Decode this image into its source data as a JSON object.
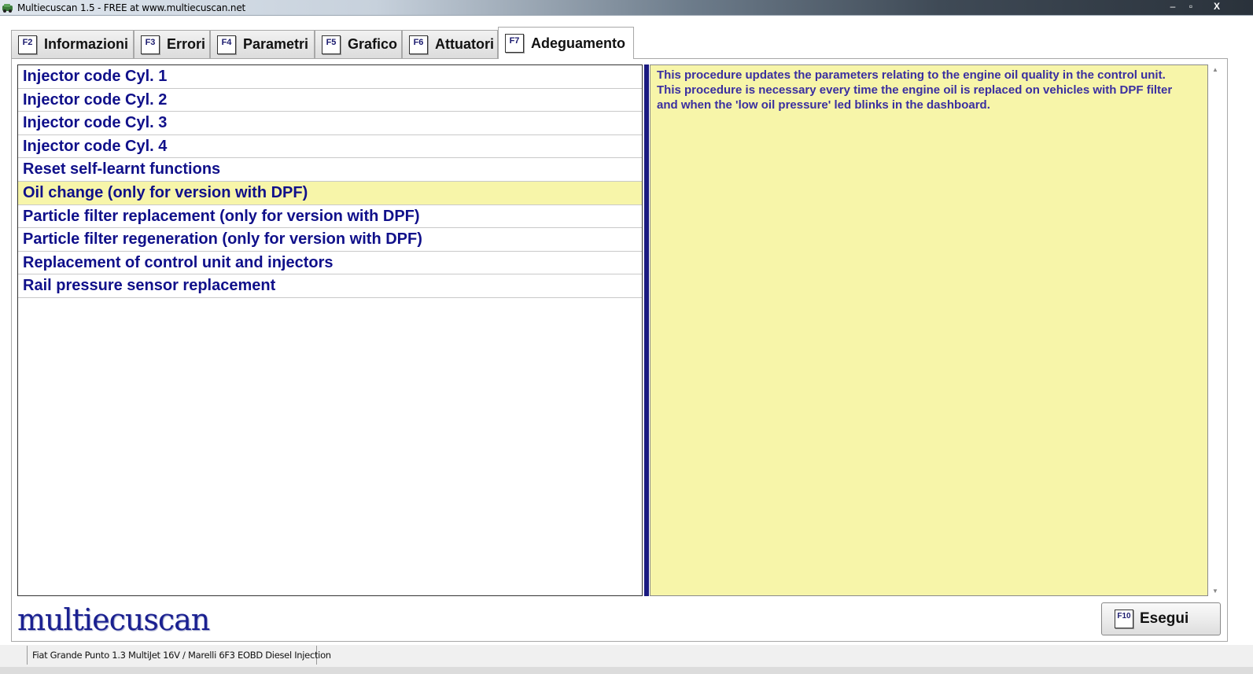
{
  "window": {
    "title": "Multiecuscan 1.5 - FREE at www.multiecuscan.net",
    "minimize_glyph": "‒",
    "maximize_glyph": "▫",
    "close_glyph": "X"
  },
  "tabs": [
    {
      "key": "F2",
      "label": "Informazioni",
      "active": false
    },
    {
      "key": "F3",
      "label": "Errori",
      "active": false
    },
    {
      "key": "F4",
      "label": "Parametri",
      "active": false
    },
    {
      "key": "F5",
      "label": "Grafico",
      "active": false
    },
    {
      "key": "F6",
      "label": "Attuatori",
      "active": false
    },
    {
      "key": "F7",
      "label": "Adeguamento",
      "active": true
    }
  ],
  "procedures": [
    {
      "label": "Injector code Cyl. 1",
      "selected": false
    },
    {
      "label": "Injector code Cyl. 2",
      "selected": false
    },
    {
      "label": "Injector code Cyl. 3",
      "selected": false
    },
    {
      "label": "Injector code Cyl. 4",
      "selected": false
    },
    {
      "label": "Reset self-learnt functions",
      "selected": false
    },
    {
      "label": "Oil change (only for version with DPF)",
      "selected": true
    },
    {
      "label": "Particle filter replacement (only for version with DPF)",
      "selected": false
    },
    {
      "label": "Particle filter regeneration (only for version with DPF)",
      "selected": false
    },
    {
      "label": "Replacement of control unit and injectors",
      "selected": false
    },
    {
      "label": "Rail pressure sensor replacement",
      "selected": false
    }
  ],
  "description": {
    "line1": "This procedure updates the parameters relating to the engine oil quality in the control unit.",
    "line2": "This procedure is necessary every time the engine oil is replaced on vehicles with DPF filter",
    "line3": "and when the 'low oil pressure' led blinks in the dashboard."
  },
  "logo": {
    "text": "multiecuscan"
  },
  "execute_button": {
    "key": "F10",
    "label": "Esegui"
  },
  "status": {
    "vehicle": "Fiat Grande Punto 1.3 MultiJet 16V / Marelli 6F3 EOBD Diesel Injection"
  },
  "colors": {
    "item_text": "#10108a",
    "selected_bg": "#f7f5a9",
    "description_bg": "#f7f5a9",
    "description_text": "#3a2fa0",
    "splitter": "#1a1a80"
  }
}
